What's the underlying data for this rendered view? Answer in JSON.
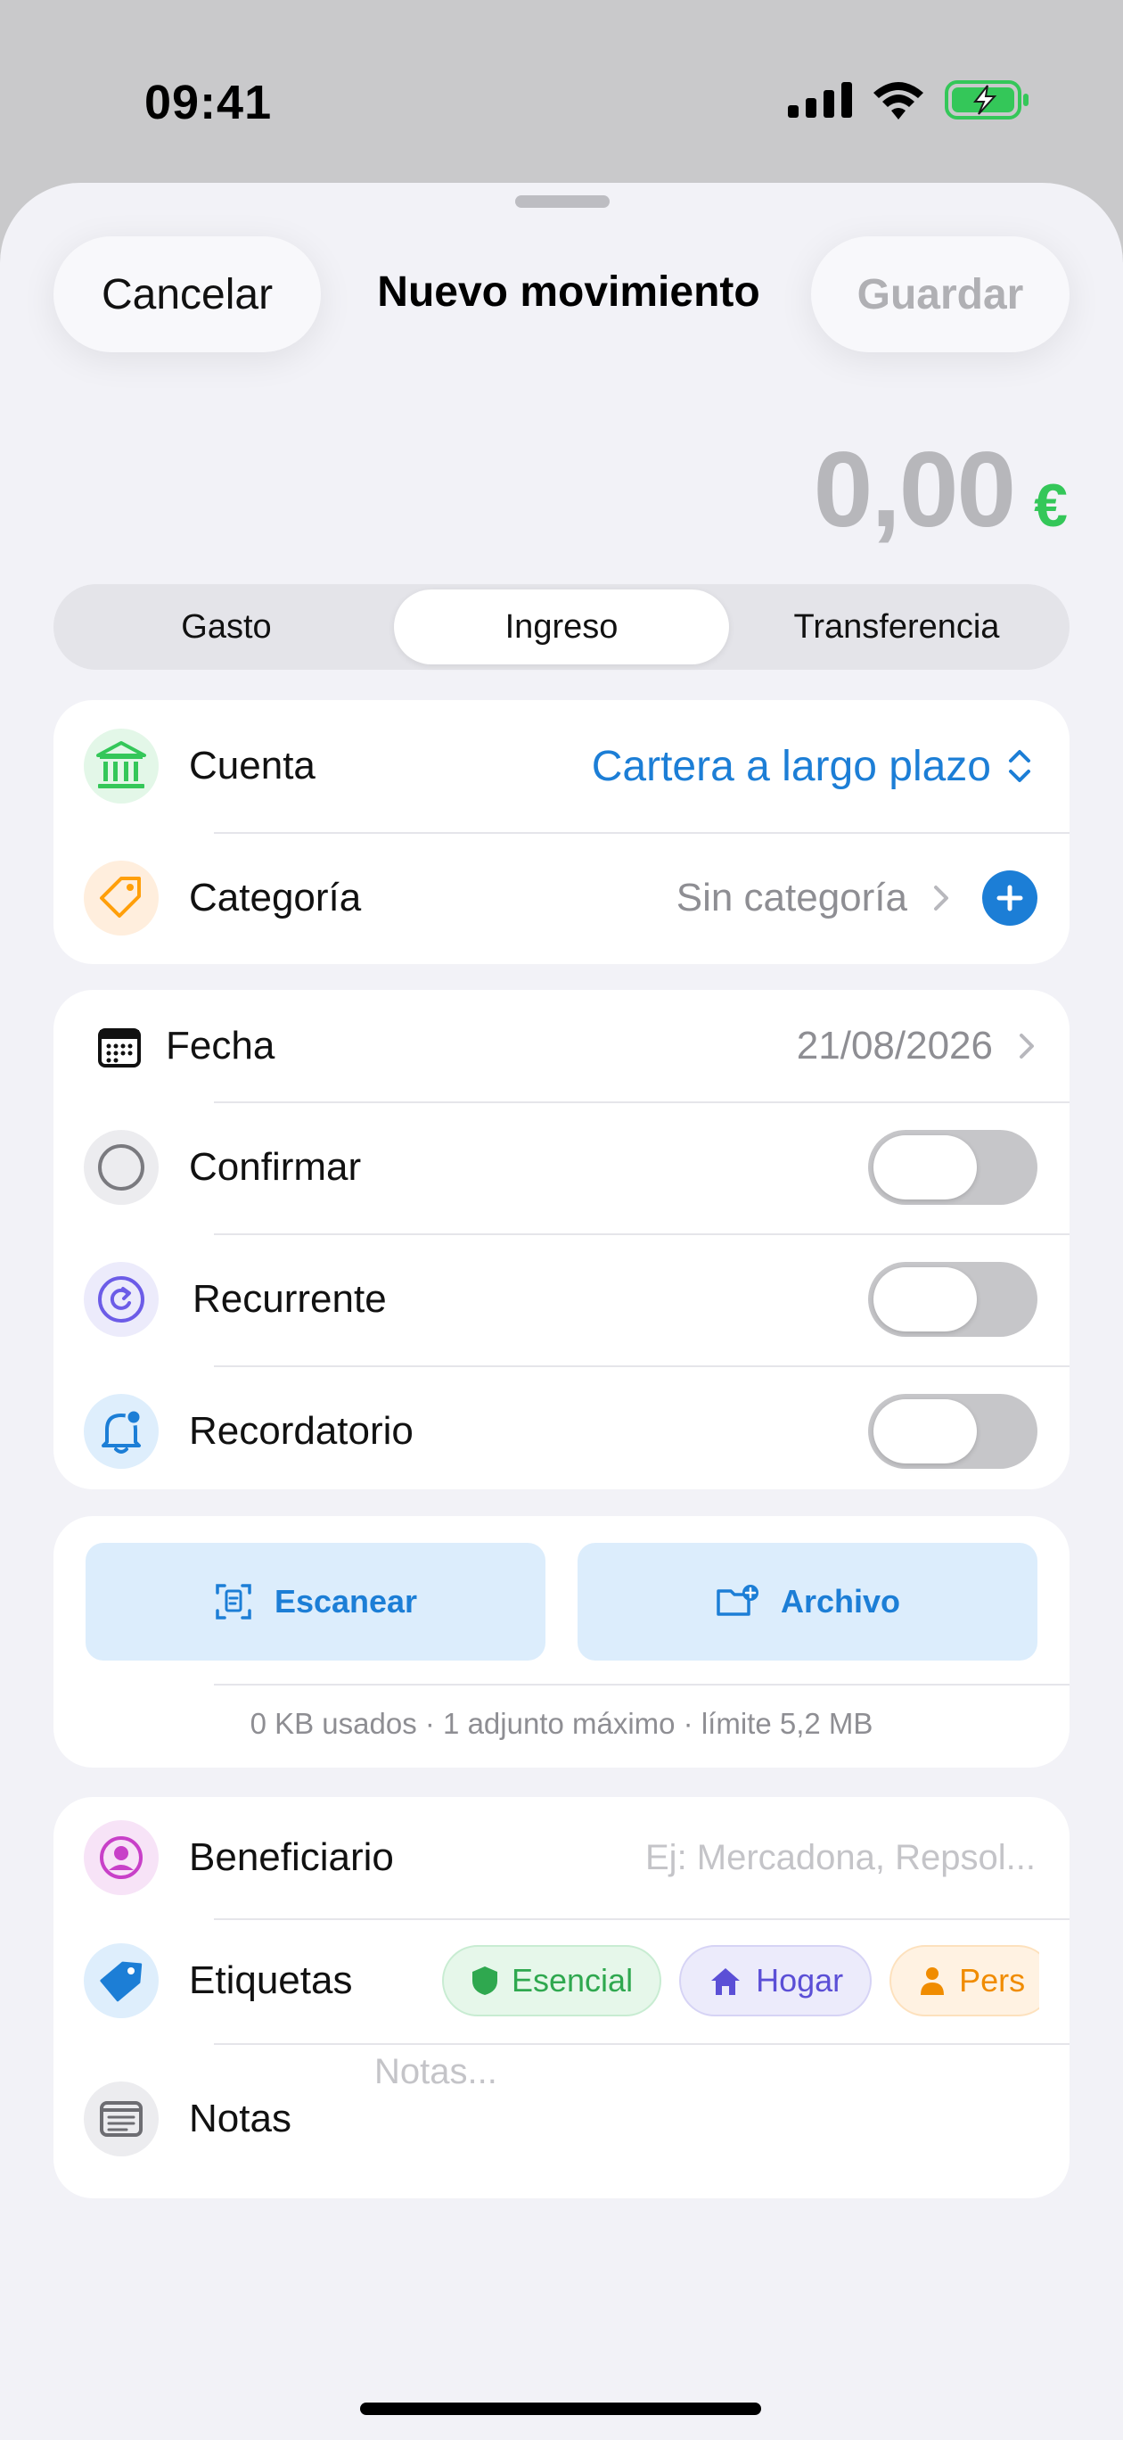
{
  "status_bar": {
    "time": "09:41",
    "icons": [
      "signal-icon",
      "wifi-icon",
      "battery-charging-icon"
    ]
  },
  "header": {
    "cancel_label": "Cancelar",
    "title": "Nuevo movimiento",
    "save_label": "Guardar"
  },
  "amount": {
    "value": "0,00",
    "currency": "€"
  },
  "type_selector": {
    "options": [
      "Gasto",
      "Ingreso",
      "Transferencia"
    ],
    "selected": "Ingreso"
  },
  "main_card": {
    "account_label": "Cuenta",
    "account_value": "Cartera a largo plazo",
    "category_label": "Categoría",
    "category_value": "Sin categoría"
  },
  "date_card": {
    "date_label": "Fecha",
    "date_value": "21/08/2026",
    "confirm_label": "Confirmar",
    "recurring_label": "Recurrente",
    "reminder_label": "Recordatorio"
  },
  "toggles": {
    "confirm": false,
    "recurring": false,
    "reminder": false
  },
  "attachments": {
    "scan_label": "Escanear",
    "file_label": "Archivo",
    "info": "0 KB usados · 1 adjunto máximo · límite 5,2 MB"
  },
  "details_card": {
    "payee_label": "Beneficiario",
    "payee_placeholder": "Ej: Mercadona, Repsol...",
    "tags_label": "Etiquetas",
    "tags": [
      "Esencial",
      "Hogar",
      "Pers"
    ],
    "notes_label": "Notas",
    "notes_placeholder": "Notas..."
  },
  "colors": {
    "accent_blue": "#1c7ed6",
    "green": "#34c759",
    "orange": "#ff9f0a",
    "purple": "#6c5ce7"
  }
}
